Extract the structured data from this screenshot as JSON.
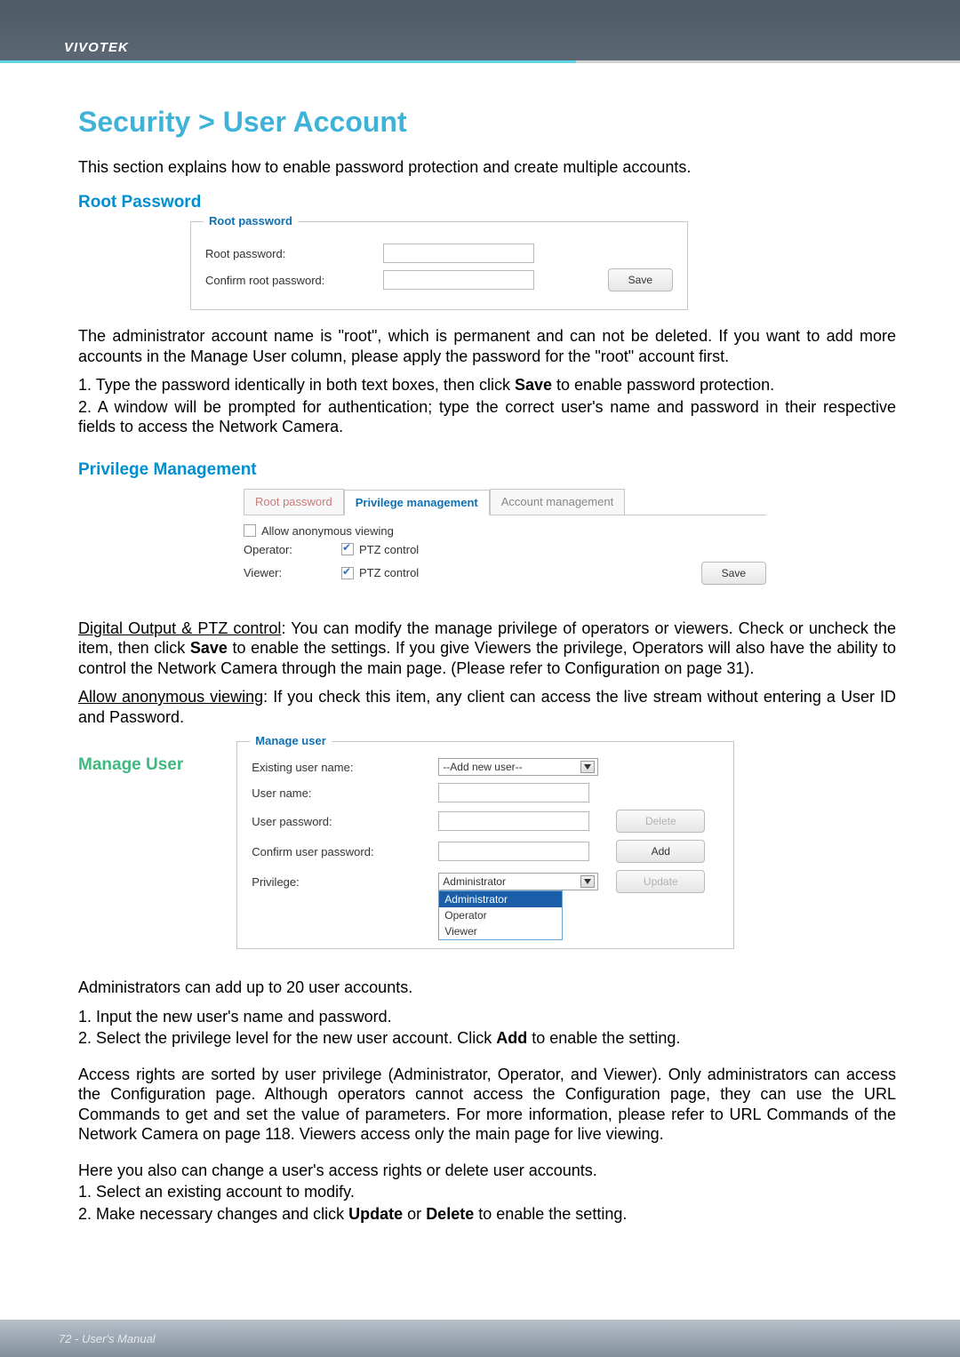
{
  "header": {
    "brand": "VIVOTEK"
  },
  "page_title": "Security > User Account",
  "intro": "This section explains how to enable password protection and create multiple accounts.",
  "sections": {
    "root_password": {
      "heading": "Root Password",
      "legend": "Root password",
      "rows": {
        "root_pw_label": "Root password:",
        "confirm_label": "Confirm root password:"
      },
      "save_label": "Save",
      "para1": "The administrator account name is \"root\", which is permanent and can not be deleted. If you want to add more accounts in the Manage User column, please apply the password for the \"root\" account first.",
      "step1": "1. Type the password identically in both text boxes, then click Save to enable password protection.",
      "step2": "2. A window will be prompted for authentication; type the correct user's name and password in their respective fields to access the Network Camera."
    },
    "privilege": {
      "heading": "Privilege Management",
      "tabs": {
        "root": "Root password",
        "priv": "Privilege management",
        "acct": "Account management"
      },
      "allow_anon": "Allow anonymous viewing",
      "operator_label": "Operator:",
      "viewer_label": "Viewer:",
      "ptz_label": "PTZ control",
      "save_label": "Save",
      "para_do_ptz_prefix": "Digital Output & PTZ control",
      "para_do_ptz": ": You can modify the manage privilege of operators or viewers. Check or uncheck the item, then click Save to enable the settings. If you give Viewers the privilege, Operators will also have the ability to control the Network Camera through the main page. (Please refer to Configuration on page 31).",
      "para_anon_prefix": "Allow anonymous viewing",
      "para_anon": ": If you check this item, any client can access the live stream without entering a User ID and Password."
    },
    "manage_user": {
      "heading": "Manage User",
      "legend": "Manage user",
      "existing_label": "Existing user name:",
      "existing_value": "--Add new user--",
      "username_label": "User name:",
      "userpw_label": "User password:",
      "confirmpw_label": "Confirm user password:",
      "privilege_label": "Privilege:",
      "privilege_options": {
        "admin": "Administrator",
        "operator": "Operator",
        "viewer": "Viewer"
      },
      "delete_label": "Delete",
      "add_label": "Add",
      "update_label": "Update",
      "para1": "Administrators can add up to 20 user accounts.",
      "step1": "1. Input the new user's name and password.",
      "step2": "2. Select the privilege level for the new user account. Click Add to enable the setting.",
      "para2": "Access rights are sorted by user privilege (Administrator, Operator, and Viewer). Only administrators can access the Configuration page. Although operators cannot access the Configuration page, they can use the URL Commands to get and set the value of parameters. For more information, please refer to URL Commands of the Network Camera on page 118. Viewers access only the main page for live viewing.",
      "para3": "Here you also can change a user's access rights or delete user accounts.",
      "step3": "1. Select an existing account to modify.",
      "step4": "2. Make necessary changes and click Update or Delete to enable the setting."
    }
  },
  "footer": {
    "text": "72 - User's Manual"
  }
}
